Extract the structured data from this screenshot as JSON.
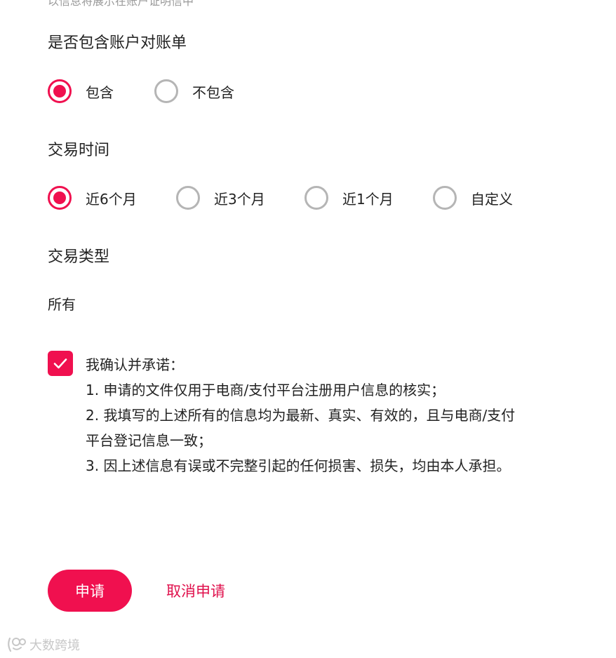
{
  "top_cut_text": "以信息将展示在账户证明信中",
  "statement_section": {
    "title": "是否包含账户对账单",
    "options": [
      {
        "label": "包含",
        "selected": true
      },
      {
        "label": "不包含",
        "selected": false
      }
    ]
  },
  "time_section": {
    "title": "交易时间",
    "options": [
      {
        "label": "近6个月",
        "selected": true
      },
      {
        "label": "近3个月",
        "selected": false
      },
      {
        "label": "近1个月",
        "selected": false
      },
      {
        "label": "自定义",
        "selected": false
      }
    ]
  },
  "type_section": {
    "title": "交易类型",
    "value": "所有"
  },
  "declaration": {
    "checked": true,
    "lines": [
      "我确认并承诺：",
      "1. 申请的文件仅用于电商/支付平台注册用户信息的核实；",
      "2. 我填写的上述所有的信息均为最新、真实、有效的，且与电商/支付平台登记信息一致；",
      "3. 因上述信息有误或不完整引起的任何损害、损失，均由本人承担。"
    ]
  },
  "actions": {
    "apply_label": "申请",
    "cancel_label": "取消申请"
  },
  "watermark": {
    "text": "大数跨境",
    "icon": "watermark-logo-icon"
  },
  "colors": {
    "accent": "#f0104f",
    "text": "#222222",
    "radio_unselected": "#b5b5b5"
  }
}
